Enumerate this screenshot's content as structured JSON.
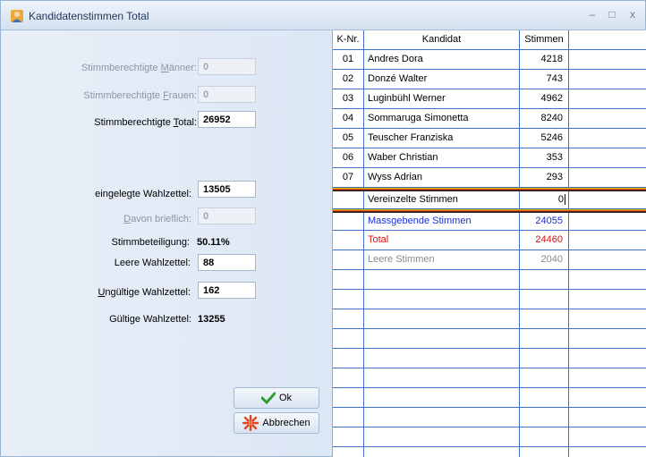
{
  "window": {
    "title": "Kandidatenstimmen Total",
    "controls": {
      "minimize": "–",
      "maximize": "□",
      "close": "x"
    }
  },
  "form": {
    "maenner_label_pre": "Stimmberechtigte ",
    "maenner_label_u": "M",
    "maenner_label_post": "änner:",
    "maenner_value": "0",
    "frauen_label_pre": "Stimmberechtigte ",
    "frauen_label_u": "F",
    "frauen_label_post": "rauen:",
    "frauen_value": "0",
    "total_label_pre": "Stimmberechtigte ",
    "total_label_u": "T",
    "total_label_post": "otal:",
    "total_value": "26952",
    "eingelegte_label_pre": "eingele",
    "eingelegte_label_u": "g",
    "eingelegte_label_post": "te Wahlzettel:",
    "eingelegte_value": "13505",
    "brieflich_label_u": "D",
    "brieflich_label_post": "avon brieflich:",
    "brieflich_value": "0",
    "beteiligung_label": "Stimmbeteiligung:",
    "beteiligung_value": "50.11%",
    "leere_label": "Leere Wahlzettel:",
    "leere_value": "88",
    "ungueltige_label_u": "U",
    "ungueltige_label_post": "ngültige Wahlzettel:",
    "ungueltige_value": "162",
    "gueltige_label": "Gültige Wahlzettel:",
    "gueltige_value": "13255"
  },
  "buttons": {
    "ok": "Ok",
    "cancel": "Abbrechen"
  },
  "table": {
    "columns": [
      "K-Nr.",
      "Kandidat",
      "Stimmen"
    ],
    "rows": [
      {
        "nr": "01",
        "name": "Andres Dora",
        "votes": "4218"
      },
      {
        "nr": "02",
        "name": "Donzé Walter",
        "votes": "743"
      },
      {
        "nr": "03",
        "name": "Luginbühl Werner",
        "votes": "4962"
      },
      {
        "nr": "04",
        "name": "Sommaruga Simonetta",
        "votes": "8240"
      },
      {
        "nr": "05",
        "name": "Teuscher Franziska",
        "votes": "5246"
      },
      {
        "nr": "06",
        "name": "Waber Christian",
        "votes": "353"
      },
      {
        "nr": "07",
        "name": "Wyss Adrian",
        "votes": "293"
      }
    ],
    "vereinzelte": {
      "name": "Vereinzelte Stimmen",
      "votes": "0"
    },
    "massgebende": {
      "name": "Massgebende Stimmen",
      "votes": "24055",
      "color": "#1a2fd6"
    },
    "total": {
      "name": "Total",
      "votes": "24460",
      "color": "#e01010"
    },
    "leere": {
      "name": "Leere Stimmen",
      "votes": "2040",
      "color": "#8a8a8a"
    }
  }
}
